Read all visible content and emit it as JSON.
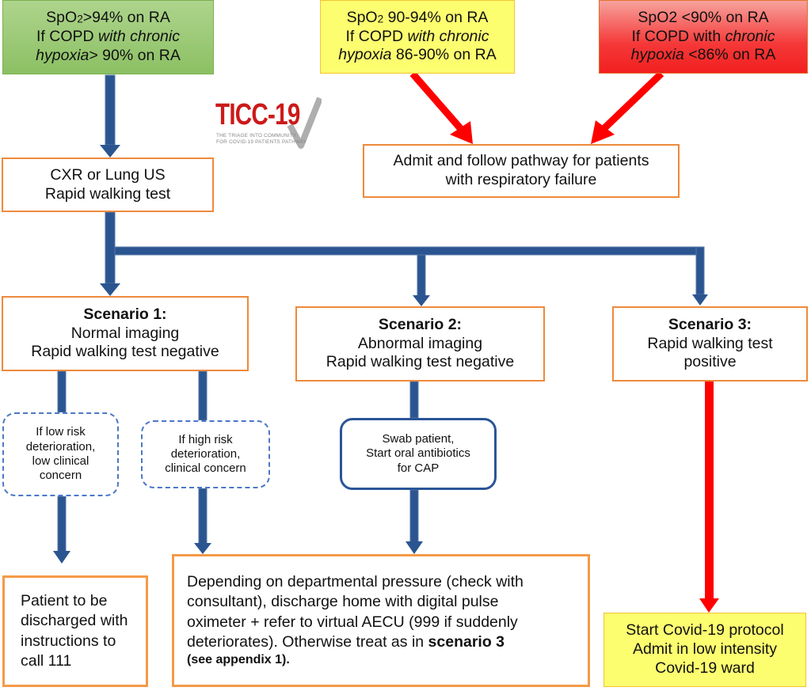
{
  "title": "TICC-19 Triage Into Community for Covid-19 Patients Pathway",
  "logo": {
    "main": "TICC-19",
    "sub_line1": "THE TRIAGE INTO COMMUNITY",
    "sub_line2": "FOR COVID-19 PATIENTS PATHWAY",
    "icon": "checkmark-icon"
  },
  "colors": {
    "blue_arrow": "#2b5590",
    "red_arrow": "#ff0000",
    "green_box": "#9bcb74",
    "yellow_box": "#fdfd70",
    "red_box": "#f53838",
    "orange_border": "#ed8a3c"
  },
  "entry": {
    "green": {
      "line1_a": "SpO",
      "line1_sub": "2",
      "line1_b": ">94% on RA",
      "line2_a": "If COPD ",
      "line2_i": "with chronic",
      "line3_i": "hypoxia",
      "line3_b": "> 90% on RA"
    },
    "yellow": {
      "line1_a": "SpO",
      "line1_sub": "2",
      "line1_b": " 90-94% on RA",
      "line2_a": "If COPD ",
      "line2_i": "with chronic",
      "line3_i": "hypoxia",
      "line3_b": " 86-90% on RA"
    },
    "red": {
      "line1": "SpO2 <90% on RA",
      "line2_a": "If COPD with ",
      "line2_i": "chronic",
      "line3_i": "hypoxia",
      "line3_b": " <86% on RA"
    }
  },
  "nodes": {
    "imaging": {
      "line1": "CXR or Lung US",
      "line2": "Rapid walking test"
    },
    "respiratory_failure": {
      "line1": "Admit and follow pathway for patients",
      "line2": "with respiratory failure"
    },
    "scenario1": {
      "title": "Scenario 1:",
      "line1": "Normal imaging",
      "line2": "Rapid walking test negative"
    },
    "scenario2": {
      "title": "Scenario 2:",
      "line1": "Abnormal imaging",
      "line2": "Rapid walking test negative"
    },
    "scenario3": {
      "title": "Scenario 3:",
      "line1": "Rapid walking test",
      "line2": "positive"
    },
    "low_risk": {
      "line1": "If low risk",
      "line2": "deterioration,",
      "line3": "low clinical",
      "line4": "concern"
    },
    "high_risk": {
      "line1": "If high risk",
      "line2": "deterioration,",
      "line3": "clinical concern"
    },
    "swab": {
      "line1": "Swab patient,",
      "line2": "Start oral antibiotics",
      "line3": "for CAP"
    },
    "discharge111": {
      "line1": "Patient to be",
      "line2": "discharged with",
      "line3": "instructions to",
      "line4": "call 111"
    },
    "departmental": {
      "line1": "Depending on departmental pressure (check with",
      "line2": "consultant), discharge home with digital pulse",
      "line3": "oximeter + refer to virtual AECU (999 if suddenly",
      "line4_a": "deteriorates). Otherwise treat as in ",
      "line4_b": "scenario 3",
      "line5_b": "(see appendix 1)."
    },
    "covid_protocol": {
      "line1": "Start Covid-19 protocol",
      "line2": "Admit in low intensity",
      "line3": "Covid-19 ward"
    }
  }
}
